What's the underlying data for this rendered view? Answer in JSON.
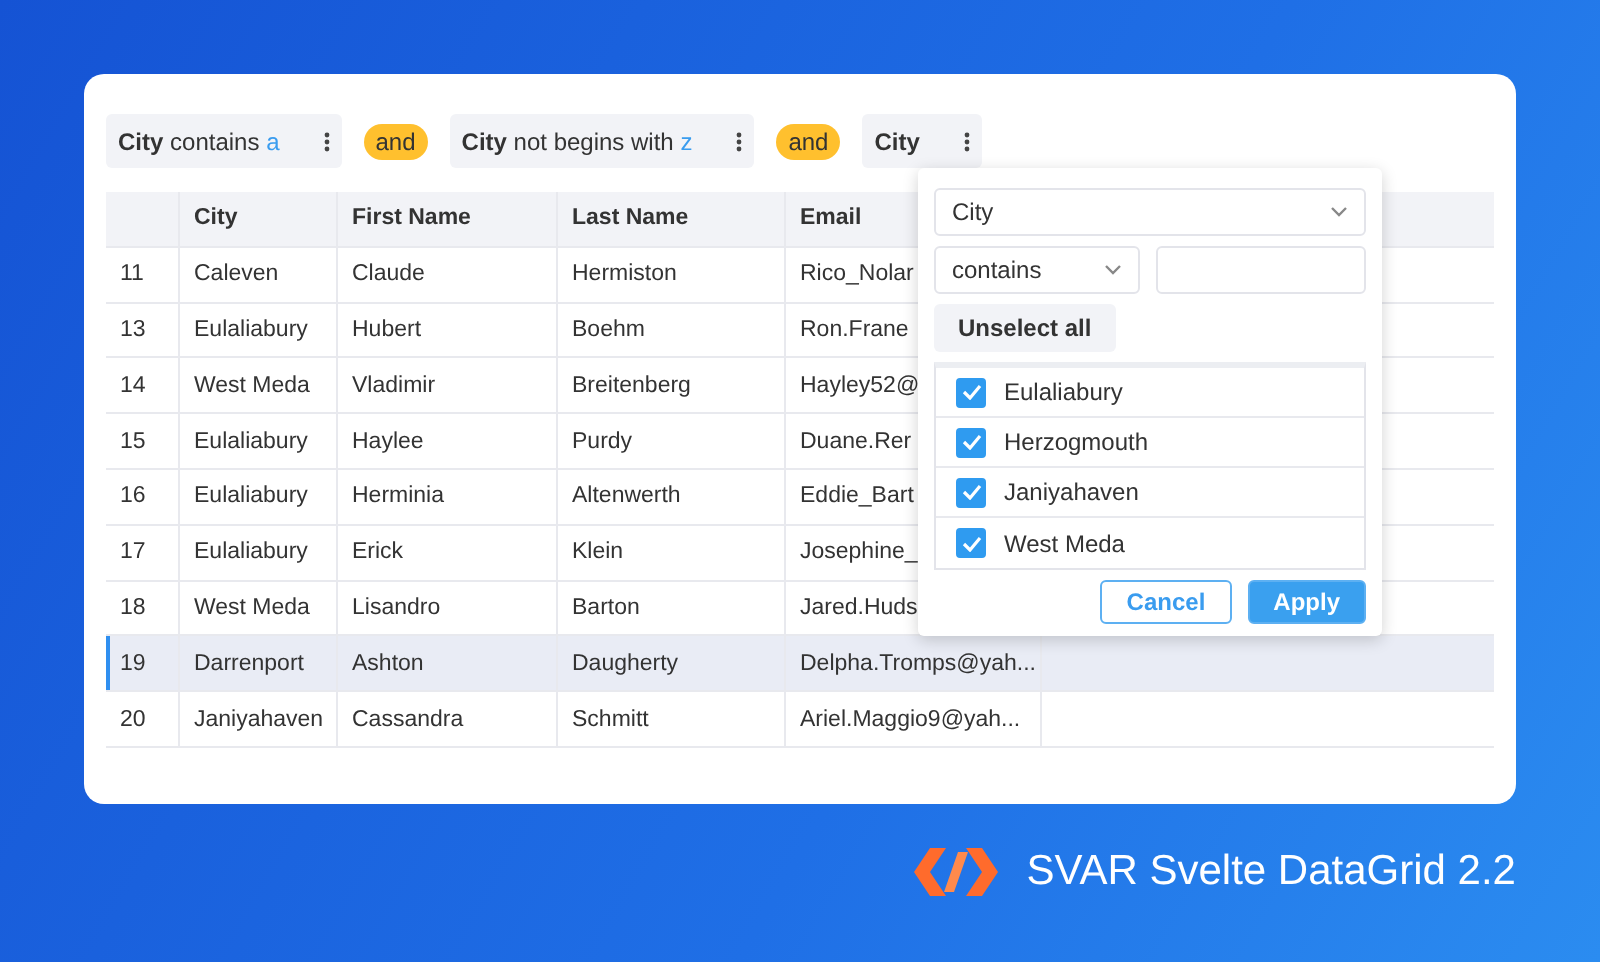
{
  "filters": [
    {
      "field": "City",
      "operator": "contains",
      "value": "a"
    },
    {
      "joiner": "and"
    },
    {
      "field": "City",
      "operator": "not begins with",
      "value": "z"
    },
    {
      "joiner": "and"
    },
    {
      "field": "City"
    }
  ],
  "table": {
    "columns": [
      "City",
      "First Name",
      "Last Name",
      "Email"
    ],
    "rows": [
      {
        "id": "11",
        "cells": [
          "Caleven",
          "Claude",
          "Hermiston",
          "Rico_Nolar"
        ],
        "selected": false
      },
      {
        "id": "13",
        "cells": [
          "Eulaliabury",
          "Hubert",
          "Boehm",
          "Ron.Frane"
        ],
        "selected": false
      },
      {
        "id": "14",
        "cells": [
          "West Meda",
          "Vladimir",
          "Breitenberg",
          "Hayley52@"
        ],
        "selected": false
      },
      {
        "id": "15",
        "cells": [
          "Eulaliabury",
          "Haylee",
          "Purdy",
          "Duane.Rer"
        ],
        "selected": false
      },
      {
        "id": "16",
        "cells": [
          "Eulaliabury",
          "Herminia",
          "Altenwerth",
          "Eddie_Bart"
        ],
        "selected": false
      },
      {
        "id": "17",
        "cells": [
          "Eulaliabury",
          "Erick",
          "Klein",
          "Josephine_"
        ],
        "selected": false
      },
      {
        "id": "18",
        "cells": [
          "West Meda",
          "Lisandro",
          "Barton",
          "Jared.Huds"
        ],
        "selected": false
      },
      {
        "id": "19",
        "cells": [
          "Darrenport",
          "Ashton",
          "Daugherty",
          "Delpha.Tromps@yah..."
        ],
        "selected": true
      },
      {
        "id": "20",
        "cells": [
          "Janiyahaven",
          "Cassandra",
          "Schmitt",
          "Ariel.Maggio9@yah..."
        ],
        "selected": false
      }
    ]
  },
  "popup": {
    "field": "City",
    "operator": "contains",
    "unselect_button": "Unselect all",
    "options": [
      {
        "label": "Eulaliabury",
        "checked": true
      },
      {
        "label": "Herzogmouth",
        "checked": true
      },
      {
        "label": "Janiyahaven",
        "checked": true
      },
      {
        "label": "West Meda",
        "checked": true
      }
    ],
    "cancel_button": "Cancel",
    "apply_button": "Apply"
  },
  "brand": {
    "title": "SVAR Svelte DataGrid 2.2"
  }
}
